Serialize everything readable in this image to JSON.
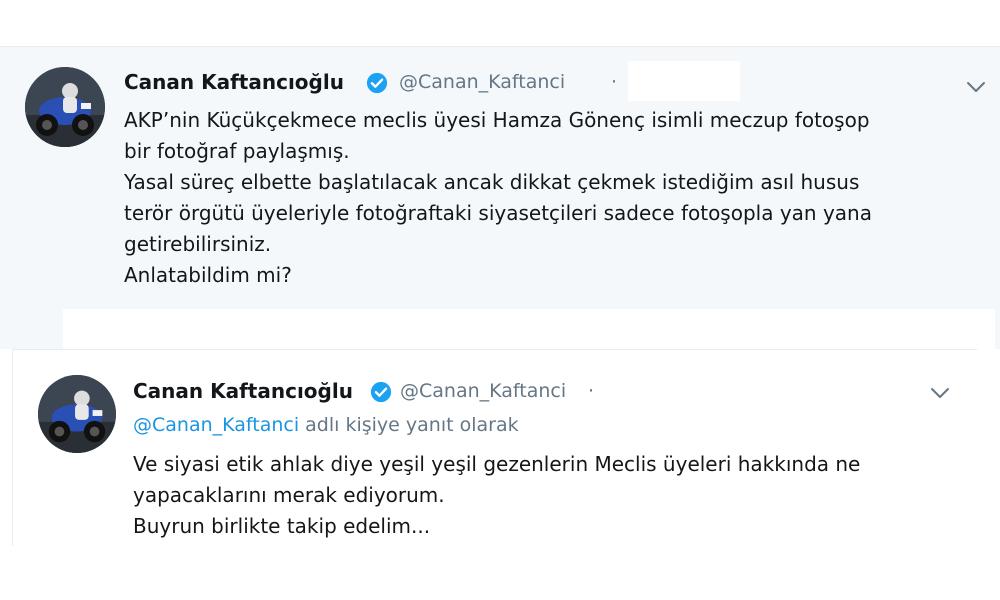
{
  "tweets": [
    {
      "author_name": "Canan Kaftancıoğlu",
      "handle": "@Canan_Kaftanci",
      "separator": "·",
      "verified": true,
      "lines": [
        "AKP’nin Küçükçekmece meclis üyesi Hamza Gönenç isimli meczup fotoşop",
        "bir fotoğraf paylaşmış.",
        "Yasal süreç elbette başlatılacak ancak dikkat çekmek istediğim asıl husus",
        "terör örgütü üyeleriyle fotoğraftaki siyasetçileri sadece fotoşopla yan yana",
        "getirebilirsiniz.",
        "Anlatabildim mi?"
      ]
    },
    {
      "author_name": "Canan Kaftancıoğlu",
      "handle": "@Canan_Kaftanci",
      "separator": "·",
      "verified": true,
      "reply_to_mention": "@Canan_Kaftanci",
      "reply_to_suffix": " adlı kişiye yanıt olarak",
      "lines": [
        "Ve siyasi etik ahlak diye yeşil yeşil gezenlerin Meclis üyeleri hakkında ne",
        "yapacaklarını merak ediyorum.",
        "Buyrun birlikte takip edelim..."
      ]
    }
  ],
  "icons": {
    "verified": "verified-badge-icon",
    "menu": "chevron-down-icon",
    "avatar": "profile-photo-motorcycle"
  },
  "colors": {
    "name": "#14171a",
    "secondary": "#657786",
    "link": "#1b95e0",
    "verified": "#1da1f2",
    "tweet_bg": "#f5f8fa"
  }
}
